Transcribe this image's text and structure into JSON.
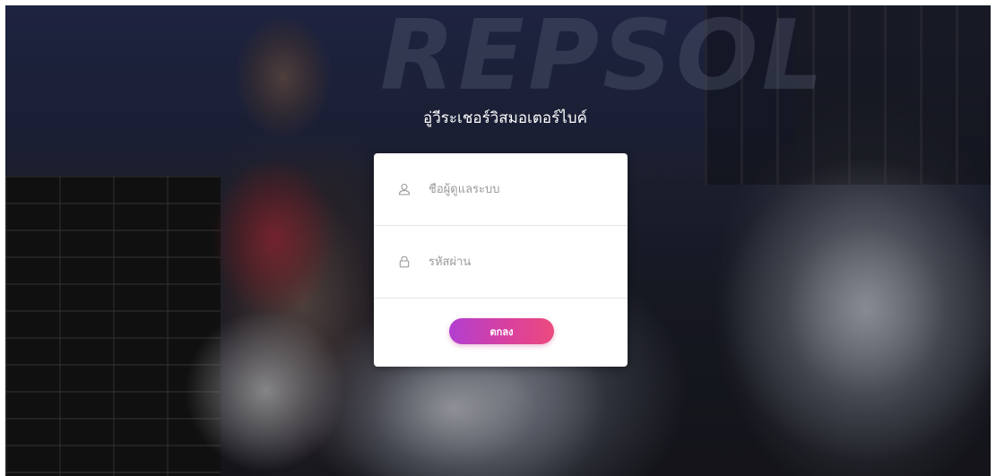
{
  "background": {
    "brand_text": "REPSOL"
  },
  "login": {
    "title": "อู่วีระเชอร์วิสมอเตอร์ไบค์",
    "username": {
      "placeholder": "ชื่อผู้ดูแลระบบ",
      "value": "",
      "icon": "user-icon"
    },
    "password": {
      "placeholder": "รหัสผ่าน",
      "value": "",
      "icon": "lock-icon"
    },
    "submit_label": "ตกลง"
  },
  "colors": {
    "button_gradient_start": "#b23fd0",
    "button_gradient_end": "#ec4a7e",
    "card_background": "#ffffff",
    "icon_gray": "#9a9a9a"
  }
}
